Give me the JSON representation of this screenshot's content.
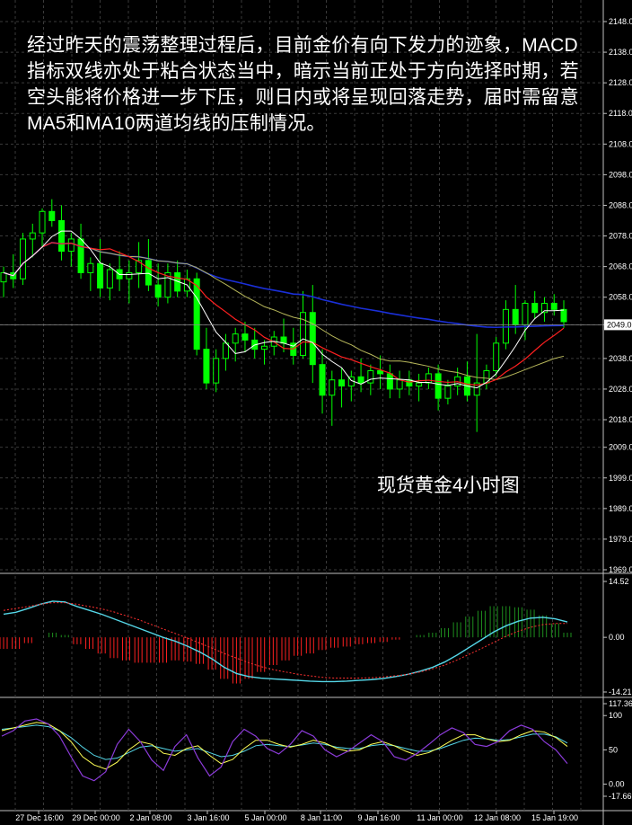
{
  "annotation": {
    "paragraph": "经过昨天的震荡整理过程后，目前金价有向下发力的迹象，MACD指标双线亦处于粘合状态当中，暗示当前正处于方向选择时期，若空头能将价格进一步下压，则日内或将呈现回落走势，届时需留意MA5和MA10两道均线的压制情况。",
    "chart_label": "现货黄金4小时图"
  },
  "chart_data": [
    {
      "type": "candlestick",
      "instrument_label": "现货黄金4小时图",
      "y_ticks": [
        "2148.0",
        "2138.0",
        "2128.0",
        "2118.0",
        "2108.0",
        "2098.0",
        "2088.0",
        "2078.0",
        "2068.0",
        "2058.0",
        "2049.0",
        "2038.0",
        "2028.0",
        "2018.0",
        "2009.0",
        "1999.0",
        "1989.0",
        "1979.0",
        "1969.0"
      ],
      "current_price": "2049.0",
      "ylim": [
        1969,
        2148
      ],
      "x_ticks": [
        "27 Dec 16:00",
        "29 Dec 00:00",
        "2 Jan 08:00",
        "3 Jan 16:00",
        "5 Jan 00:00",
        "8 Jan 11:00",
        "9 Jan 16:00",
        "11 Jan 00:00",
        "12 Jan 08:00",
        "15 Jan 19:00"
      ],
      "candles": [
        [
          2063,
          2068,
          2058,
          2066
        ],
        [
          2066,
          2072,
          2061,
          2064
        ],
        [
          2064,
          2079,
          2062,
          2077
        ],
        [
          2077,
          2082,
          2071,
          2079
        ],
        [
          2079,
          2087,
          2074,
          2086
        ],
        [
          2086,
          2090,
          2081,
          2083
        ],
        [
          2083,
          2088,
          2070,
          2073
        ],
        [
          2073,
          2079,
          2068,
          2077
        ],
        [
          2077,
          2082,
          2064,
          2066
        ],
        [
          2066,
          2071,
          2060,
          2069
        ],
        [
          2069,
          2077,
          2058,
          2061
        ],
        [
          2061,
          2069,
          2057,
          2067
        ],
        [
          2067,
          2073,
          2060,
          2064
        ],
        [
          2064,
          2070,
          2056,
          2066
        ],
        [
          2066,
          2076,
          2061,
          2070
        ],
        [
          2070,
          2077,
          2060,
          2062
        ],
        [
          2062,
          2069,
          2055,
          2058
        ],
        [
          2058,
          2069,
          2056,
          2066
        ],
        [
          2066,
          2070,
          2058,
          2060
        ],
        [
          2060,
          2067,
          2058,
          2064
        ],
        [
          2064,
          2066,
          2039,
          2041
        ],
        [
          2041,
          2048,
          2028,
          2030
        ],
        [
          2030,
          2041,
          2027,
          2038
        ],
        [
          2038,
          2046,
          2034,
          2043
        ],
        [
          2043,
          2048,
          2037,
          2046
        ],
        [
          2046,
          2050,
          2040,
          2044
        ],
        [
          2044,
          2048,
          2038,
          2041
        ],
        [
          2041,
          2044,
          2036,
          2042
        ],
        [
          2042,
          2047,
          2039,
          2045
        ],
        [
          2045,
          2051,
          2040,
          2043
        ],
        [
          2043,
          2048,
          2036,
          2039
        ],
        [
          2039,
          2060,
          2038,
          2053
        ],
        [
          2053,
          2062,
          2030,
          2036
        ],
        [
          2036,
          2041,
          2020,
          2026
        ],
        [
          2026,
          2034,
          2016,
          2031
        ],
        [
          2031,
          2035,
          2022,
          2029
        ],
        [
          2029,
          2034,
          2024,
          2032
        ],
        [
          2032,
          2038,
          2027,
          2030
        ],
        [
          2030,
          2036,
          2026,
          2034
        ],
        [
          2034,
          2039,
          2028,
          2033
        ],
        [
          2033,
          2036,
          2025,
          2028
        ],
        [
          2028,
          2034,
          2025,
          2031
        ],
        [
          2031,
          2034,
          2026,
          2029
        ],
        [
          2029,
          2033,
          2024,
          2030
        ],
        [
          2030,
          2035,
          2028,
          2033
        ],
        [
          2033,
          2036,
          2021,
          2025
        ],
        [
          2025,
          2031,
          2023,
          2029
        ],
        [
          2029,
          2035,
          2026,
          2032
        ],
        [
          2032,
          2037,
          2024,
          2026
        ],
        [
          2026,
          2046,
          2014,
          2030
        ],
        [
          2030,
          2036,
          2028,
          2034
        ],
        [
          2034,
          2045,
          2032,
          2043
        ],
        [
          2043,
          2057,
          2041,
          2054
        ],
        [
          2054,
          2062,
          2046,
          2049
        ],
        [
          2049,
          2057,
          2044,
          2056
        ],
        [
          2056,
          2060,
          2051,
          2053
        ],
        [
          2053,
          2058,
          2050,
          2056
        ],
        [
          2056,
          2059,
          2052,
          2054
        ],
        [
          2054,
          2057,
          2048,
          2050
        ]
      ],
      "ma_colors": {
        "MA5": "#ffffff",
        "MA10": "#ff2020",
        "MA20": "#b6b65a",
        "MA60": "#1a2fd8"
      },
      "colors": {
        "bull": "#00ff00",
        "bear": "#00ff00",
        "grid": "#3a3a3a"
      }
    },
    {
      "type": "macd",
      "y_ticks": [
        "14.52",
        "0.00",
        "-14.21"
      ],
      "ylim": [
        -14.21,
        14.52
      ],
      "macd_line": [
        6,
        6.5,
        7.5,
        8.6,
        9.4,
        9.2,
        8.0,
        7.0,
        6.0,
        4.8,
        3.6,
        2.4,
        1.2,
        0.0,
        -1.0,
        -2.3,
        -3.8,
        -5.6,
        -7.8,
        -9.4,
        -10.2,
        -10.6,
        -10.8,
        -11.0,
        -11.2,
        -11.4,
        -11.5,
        -11.5,
        -11.4,
        -11.2,
        -11.0,
        -10.7,
        -10.2,
        -9.6,
        -8.8,
        -7.8,
        -6.4,
        -4.6,
        -2.6,
        -0.6,
        1.4,
        3.0,
        4.2,
        5.0,
        5.2,
        4.8,
        4.0
      ],
      "signal_line": [
        7,
        7.5,
        8.0,
        8.6,
        9.0,
        9.0,
        8.6,
        8.0,
        7.4,
        6.6,
        5.6,
        4.6,
        3.4,
        2.2,
        1.0,
        -0.2,
        -1.5,
        -2.8,
        -4.2,
        -5.4,
        -6.6,
        -7.6,
        -8.4,
        -9.0,
        -9.6,
        -10.0,
        -10.4,
        -10.6,
        -10.6,
        -10.6,
        -10.5,
        -10.3,
        -10.0,
        -9.6,
        -9.0,
        -8.2,
        -7.2,
        -5.9,
        -4.4,
        -2.9,
        -1.3,
        0.3,
        1.6,
        2.6,
        3.3,
        3.6,
        3.6
      ],
      "colors": {
        "macd": "#55d7e8",
        "signal": "#ff3030",
        "hist_pos": "#1e8f1e",
        "hist_neg": "#ff2020"
      }
    },
    {
      "type": "stochastic",
      "y_ticks": [
        "117.36",
        "100",
        "50",
        "0.00",
        "-17.669"
      ],
      "ylim": [
        -17.669,
        117.36
      ],
      "k_line": [
        70,
        78,
        92,
        95,
        88,
        70,
        40,
        12,
        5,
        18,
        58,
        80,
        62,
        35,
        20,
        55,
        72,
        38,
        12,
        25,
        62,
        80,
        70,
        52,
        44,
        58,
        78,
        70,
        50,
        40,
        48,
        60,
        72,
        62,
        40,
        35,
        45,
        58,
        72,
        82,
        75,
        58,
        55,
        62,
        78,
        86,
        80,
        62,
        50,
        30
      ],
      "d_line": [
        78,
        82,
        86,
        90,
        88,
        78,
        62,
        40,
        28,
        22,
        32,
        50,
        62,
        58,
        45,
        42,
        52,
        56,
        42,
        30,
        36,
        52,
        64,
        64,
        58,
        54,
        58,
        64,
        60,
        52,
        48,
        50,
        58,
        62,
        56,
        48,
        42,
        46,
        54,
        64,
        72,
        72,
        66,
        62,
        64,
        72,
        78,
        76,
        68,
        55
      ],
      "ma_line": [
        80,
        82,
        84,
        86,
        84,
        78,
        68,
        54,
        42,
        36,
        38,
        46,
        54,
        56,
        52,
        48,
        50,
        52,
        46,
        40,
        42,
        48,
        56,
        58,
        56,
        55,
        57,
        60,
        58,
        54,
        52,
        52,
        56,
        58,
        56,
        52,
        48,
        48,
        52,
        58,
        64,
        67,
        66,
        64,
        65,
        69,
        73,
        73,
        69,
        60
      ],
      "colors": {
        "k": "#8b3bd8",
        "d": "#ffff55",
        "ma": "#55d7e8"
      }
    }
  ]
}
